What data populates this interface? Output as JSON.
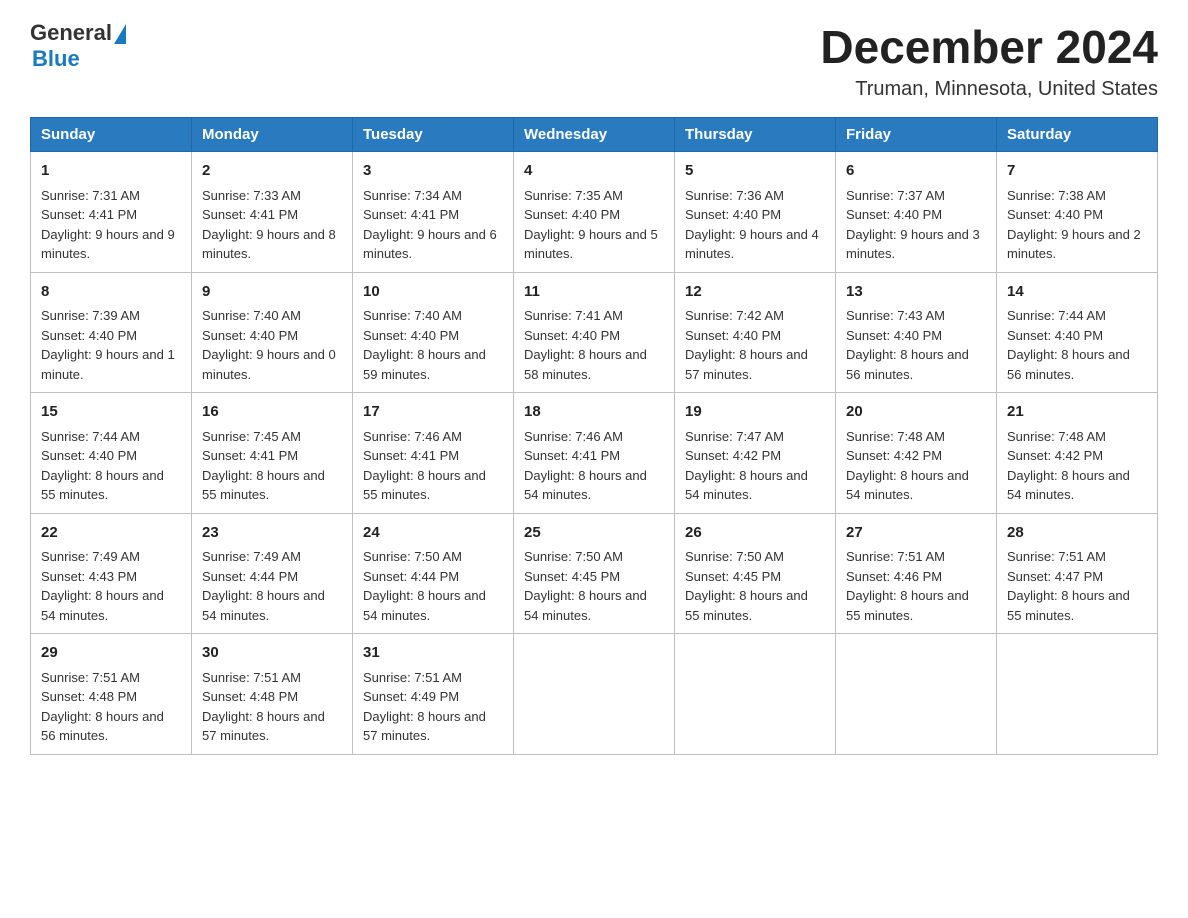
{
  "header": {
    "logo_general": "General",
    "logo_blue": "Blue",
    "title": "December 2024",
    "subtitle": "Truman, Minnesota, United States"
  },
  "days_of_week": [
    "Sunday",
    "Monday",
    "Tuesday",
    "Wednesday",
    "Thursday",
    "Friday",
    "Saturday"
  ],
  "weeks": [
    [
      {
        "day": "1",
        "sunrise": "7:31 AM",
        "sunset": "4:41 PM",
        "daylight": "9 hours and 9 minutes."
      },
      {
        "day": "2",
        "sunrise": "7:33 AM",
        "sunset": "4:41 PM",
        "daylight": "9 hours and 8 minutes."
      },
      {
        "day": "3",
        "sunrise": "7:34 AM",
        "sunset": "4:41 PM",
        "daylight": "9 hours and 6 minutes."
      },
      {
        "day": "4",
        "sunrise": "7:35 AM",
        "sunset": "4:40 PM",
        "daylight": "9 hours and 5 minutes."
      },
      {
        "day": "5",
        "sunrise": "7:36 AM",
        "sunset": "4:40 PM",
        "daylight": "9 hours and 4 minutes."
      },
      {
        "day": "6",
        "sunrise": "7:37 AM",
        "sunset": "4:40 PM",
        "daylight": "9 hours and 3 minutes."
      },
      {
        "day": "7",
        "sunrise": "7:38 AM",
        "sunset": "4:40 PM",
        "daylight": "9 hours and 2 minutes."
      }
    ],
    [
      {
        "day": "8",
        "sunrise": "7:39 AM",
        "sunset": "4:40 PM",
        "daylight": "9 hours and 1 minute."
      },
      {
        "day": "9",
        "sunrise": "7:40 AM",
        "sunset": "4:40 PM",
        "daylight": "9 hours and 0 minutes."
      },
      {
        "day": "10",
        "sunrise": "7:40 AM",
        "sunset": "4:40 PM",
        "daylight": "8 hours and 59 minutes."
      },
      {
        "day": "11",
        "sunrise": "7:41 AM",
        "sunset": "4:40 PM",
        "daylight": "8 hours and 58 minutes."
      },
      {
        "day": "12",
        "sunrise": "7:42 AM",
        "sunset": "4:40 PM",
        "daylight": "8 hours and 57 minutes."
      },
      {
        "day": "13",
        "sunrise": "7:43 AM",
        "sunset": "4:40 PM",
        "daylight": "8 hours and 56 minutes."
      },
      {
        "day": "14",
        "sunrise": "7:44 AM",
        "sunset": "4:40 PM",
        "daylight": "8 hours and 56 minutes."
      }
    ],
    [
      {
        "day": "15",
        "sunrise": "7:44 AM",
        "sunset": "4:40 PM",
        "daylight": "8 hours and 55 minutes."
      },
      {
        "day": "16",
        "sunrise": "7:45 AM",
        "sunset": "4:41 PM",
        "daylight": "8 hours and 55 minutes."
      },
      {
        "day": "17",
        "sunrise": "7:46 AM",
        "sunset": "4:41 PM",
        "daylight": "8 hours and 55 minutes."
      },
      {
        "day": "18",
        "sunrise": "7:46 AM",
        "sunset": "4:41 PM",
        "daylight": "8 hours and 54 minutes."
      },
      {
        "day": "19",
        "sunrise": "7:47 AM",
        "sunset": "4:42 PM",
        "daylight": "8 hours and 54 minutes."
      },
      {
        "day": "20",
        "sunrise": "7:48 AM",
        "sunset": "4:42 PM",
        "daylight": "8 hours and 54 minutes."
      },
      {
        "day": "21",
        "sunrise": "7:48 AM",
        "sunset": "4:42 PM",
        "daylight": "8 hours and 54 minutes."
      }
    ],
    [
      {
        "day": "22",
        "sunrise": "7:49 AM",
        "sunset": "4:43 PM",
        "daylight": "8 hours and 54 minutes."
      },
      {
        "day": "23",
        "sunrise": "7:49 AM",
        "sunset": "4:44 PM",
        "daylight": "8 hours and 54 minutes."
      },
      {
        "day": "24",
        "sunrise": "7:50 AM",
        "sunset": "4:44 PM",
        "daylight": "8 hours and 54 minutes."
      },
      {
        "day": "25",
        "sunrise": "7:50 AM",
        "sunset": "4:45 PM",
        "daylight": "8 hours and 54 minutes."
      },
      {
        "day": "26",
        "sunrise": "7:50 AM",
        "sunset": "4:45 PM",
        "daylight": "8 hours and 55 minutes."
      },
      {
        "day": "27",
        "sunrise": "7:51 AM",
        "sunset": "4:46 PM",
        "daylight": "8 hours and 55 minutes."
      },
      {
        "day": "28",
        "sunrise": "7:51 AM",
        "sunset": "4:47 PM",
        "daylight": "8 hours and 55 minutes."
      }
    ],
    [
      {
        "day": "29",
        "sunrise": "7:51 AM",
        "sunset": "4:48 PM",
        "daylight": "8 hours and 56 minutes."
      },
      {
        "day": "30",
        "sunrise": "7:51 AM",
        "sunset": "4:48 PM",
        "daylight": "8 hours and 57 minutes."
      },
      {
        "day": "31",
        "sunrise": "7:51 AM",
        "sunset": "4:49 PM",
        "daylight": "8 hours and 57 minutes."
      },
      null,
      null,
      null,
      null
    ]
  ],
  "labels": {
    "sunrise": "Sunrise:",
    "sunset": "Sunset:",
    "daylight": "Daylight:"
  }
}
